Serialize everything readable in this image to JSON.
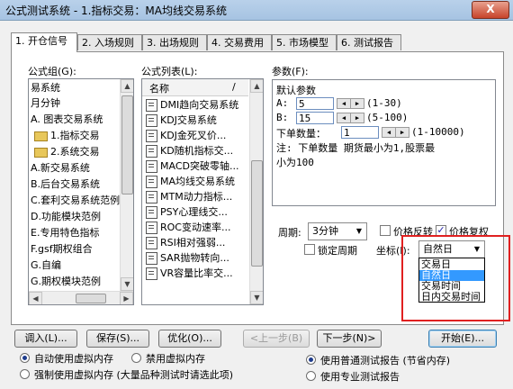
{
  "window": {
    "title": "公式测试系统 - 1.指标交易：MA均线交易系统",
    "close_label": "X"
  },
  "tabs": [
    {
      "label": "1. 开仓信号"
    },
    {
      "label": "2. 入场规则"
    },
    {
      "label": "3. 出场规则"
    },
    {
      "label": "4. 交易费用"
    },
    {
      "label": "5. 市场模型"
    },
    {
      "label": "6. 测试报告"
    }
  ],
  "group_panel": {
    "label": "公式组(G):",
    "items": [
      "易系统",
      "月分钟",
      "A. 图表交易系统",
      "1.指标交易",
      "2.系统交易",
      "A.新交易系统",
      "B.后台交易系统",
      "C.套利交易系统范例",
      "D.功能模块范例",
      "E.专用特色指标",
      "F.gsf期权组合",
      "G.自编",
      "G.期权模块范例"
    ]
  },
  "formula_panel": {
    "label": "公式列表(L):",
    "header_name": "名称",
    "header_sep": "/",
    "items": [
      "DMI趋向交易系统",
      "KDJ交易系统",
      "KDJ金死叉价...",
      "KD随机指标交...",
      "MACD突破零轴...",
      "MA均线交易系统",
      "MTM动力指标...",
      "PSY心理线交...",
      "ROC变动速率...",
      "RSI相对强弱...",
      "SAR抛物转向...",
      "VR容量比率交..."
    ]
  },
  "params": {
    "label": "参数(F):",
    "default_label": "默认参数",
    "a_label": "A:",
    "a_value": "5",
    "a_range": "(1-30)",
    "b_label": "B:",
    "b_value": "15",
    "b_range": "(5-100)",
    "qty_label": "下单数量：",
    "qty_value": "1",
    "qty_range": "(1-10000)",
    "note_line1": "注: 下单数量 期货最小为1,股票最",
    "note_line2": "小为100"
  },
  "period": {
    "label": "周期:",
    "value": "3分钟"
  },
  "checks": {
    "price_reverse": "价格反转",
    "price_restore": "价格复权",
    "lock_period": "锁定周期"
  },
  "axis": {
    "label": "坐标(I):",
    "value": "自然日",
    "options": [
      "交易日",
      "自然日",
      "交易时间",
      "日内交易时间"
    ],
    "selected": 1
  },
  "buttons": {
    "import": "调入(L)...",
    "save": "保存(S)...",
    "optimize": "优化(O)...",
    "prev": "<上一步(B)",
    "next": "下一步(N)>",
    "start": "开始(E)..."
  },
  "radios": {
    "auto_memory": "自动使用虚拟内存",
    "disable_memory": "禁用虚拟内存",
    "force_memory": "强制使用虚拟内存 (大量品种测试时请选此项)",
    "normal_report": "使用普通测试报告 (节省内存)",
    "pro_report": "使用专业测试报告"
  }
}
